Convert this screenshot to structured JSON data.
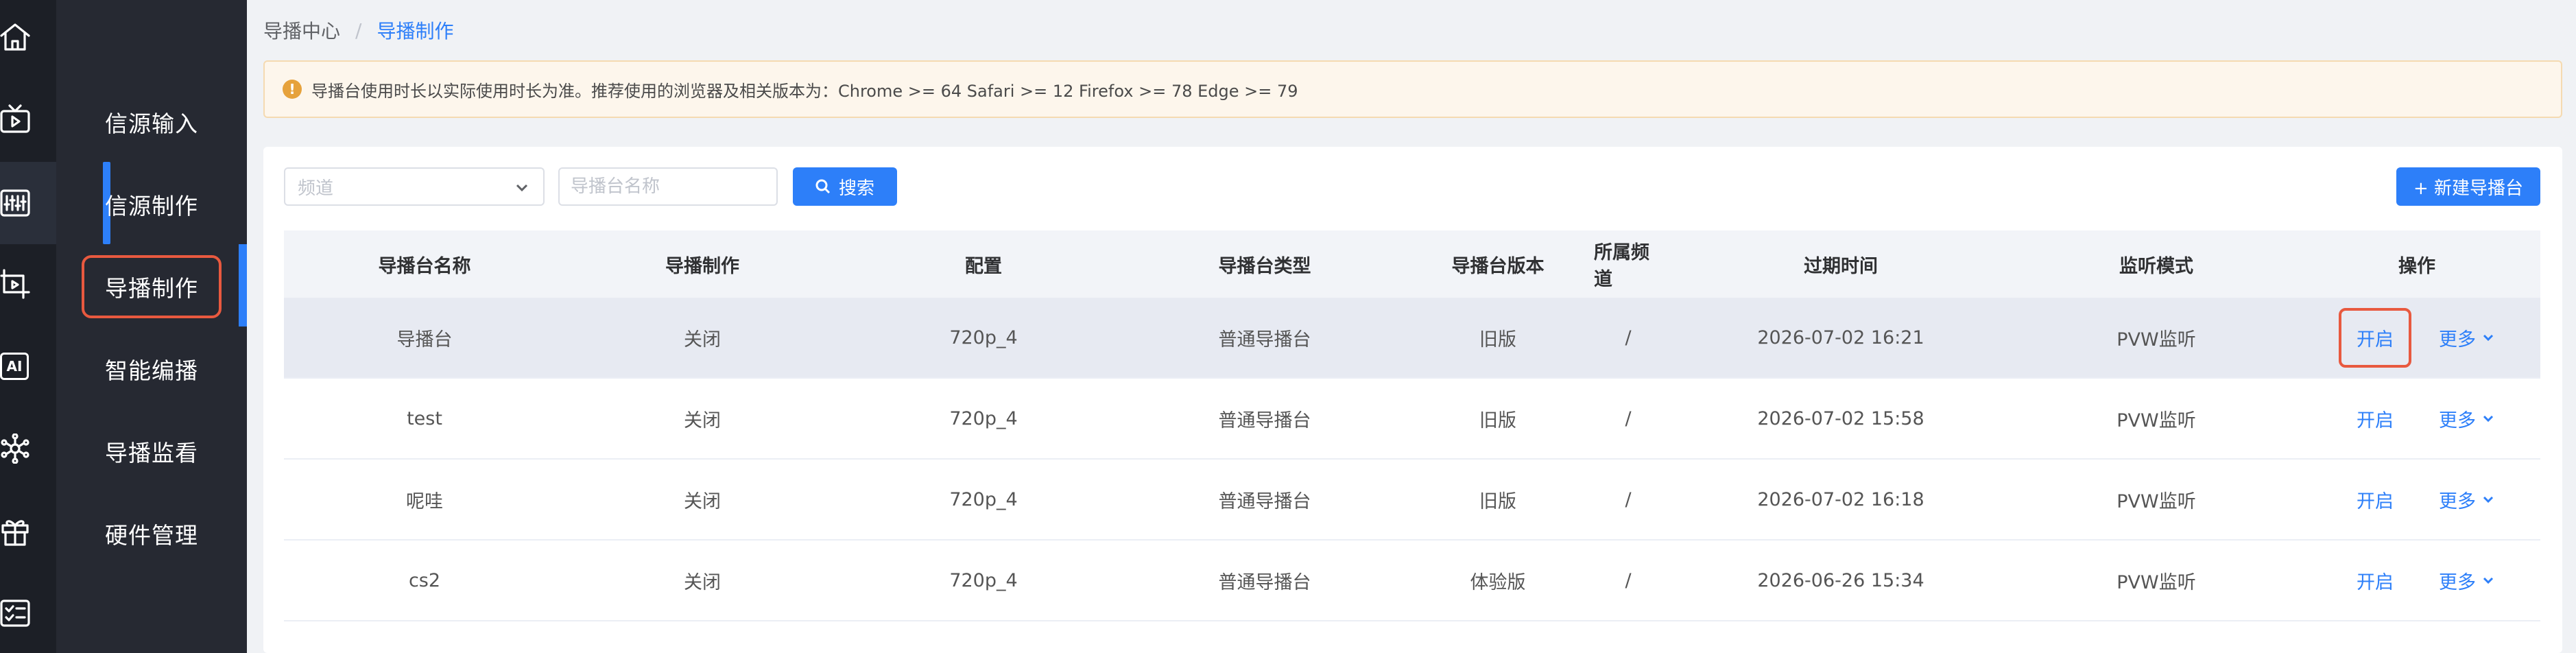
{
  "rail": {
    "icons": [
      "home-icon",
      "tv-icon",
      "studio-icon",
      "director-icon",
      "ai-icon",
      "network-icon",
      "gift-icon",
      "checklist-icon"
    ],
    "ai_label": "AI"
  },
  "subnav": {
    "items": [
      {
        "label": "信源输入"
      },
      {
        "label": "信源制作"
      },
      {
        "label": "导播制作"
      },
      {
        "label": "智能编播"
      },
      {
        "label": "导播监看"
      },
      {
        "label": "硬件管理"
      }
    ]
  },
  "breadcrumb": {
    "root": "导播中心",
    "separator": "/",
    "current": "导播制作"
  },
  "alert": {
    "icon": "!",
    "text": "导播台使用时长以实际使用时长为准。推荐使用的浏览器及相关版本为：Chrome >= 64 Safari >= 12 Firefox >= 78 Edge >= 79"
  },
  "toolbar": {
    "channel_placeholder": "频道",
    "name_placeholder": "导播台名称",
    "search_label": "搜索",
    "new_label": "+ 新建导播台"
  },
  "table": {
    "columns": [
      "导播台名称",
      "导播制作",
      "配置",
      "导播台类型",
      "导播台版本",
      "所属频道",
      "过期时间",
      "监听模式",
      "操作"
    ],
    "rows": [
      {
        "name": "导播台",
        "production": "关闭",
        "config": "720p_4",
        "type": "普通导播台",
        "version": "旧版",
        "channel": "/",
        "expire": "2026-07-02 16:21",
        "monitor": "PVW监听",
        "open": "开启",
        "more": "更多"
      },
      {
        "name": "test",
        "production": "关闭",
        "config": "720p_4",
        "type": "普通导播台",
        "version": "旧版",
        "channel": "/",
        "expire": "2026-07-02 15:58",
        "monitor": "PVW监听",
        "open": "开启",
        "more": "更多"
      },
      {
        "name": "呢哇",
        "production": "关闭",
        "config": "720p_4",
        "type": "普通导播台",
        "version": "旧版",
        "channel": "/",
        "expire": "2026-07-02 16:18",
        "monitor": "PVW监听",
        "open": "开启",
        "more": "更多"
      },
      {
        "name": "cs2",
        "production": "关闭",
        "config": "720p_4",
        "type": "普通导播台",
        "version": "体验版",
        "channel": "/",
        "expire": "2026-06-26 15:34",
        "monitor": "PVW监听",
        "open": "开启",
        "more": "更多"
      }
    ]
  },
  "colors": {
    "accent": "#2d7ff9",
    "highlight_box": "#e8593f",
    "rail_bg": "#1c1f26",
    "subnav_bg": "#262932"
  }
}
